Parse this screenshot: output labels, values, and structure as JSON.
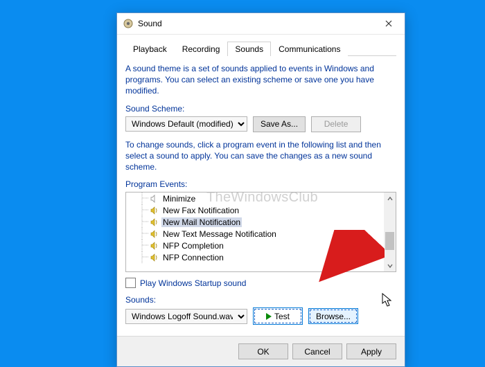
{
  "window": {
    "title": "Sound"
  },
  "tabs": [
    {
      "label": "Playback"
    },
    {
      "label": "Recording"
    },
    {
      "label": "Sounds"
    },
    {
      "label": "Communications"
    }
  ],
  "description": "A sound theme is a set of sounds applied to events in Windows and programs.  You can select an existing scheme or save one you have modified.",
  "scheme": {
    "label": "Sound Scheme:",
    "value": "Windows Default (modified)",
    "save_as": "Save As...",
    "delete": "Delete"
  },
  "events_intro": "To change sounds, click a program event in the following list and then select a sound to apply.  You can save the changes as a new sound scheme.",
  "events_label": "Program Events:",
  "events": [
    {
      "label": "Minimize",
      "has_sound": false
    },
    {
      "label": "New Fax Notification",
      "has_sound": true
    },
    {
      "label": "New Mail Notification",
      "has_sound": true,
      "selected": true
    },
    {
      "label": "New Text Message Notification",
      "has_sound": true
    },
    {
      "label": "NFP Completion",
      "has_sound": true
    },
    {
      "label": "NFP Connection",
      "has_sound": true
    }
  ],
  "startup_checkbox": "Play Windows Startup sound",
  "sounds": {
    "label": "Sounds:",
    "value": "Windows Logoff Sound.wav",
    "test": "Test",
    "browse": "Browse..."
  },
  "buttons": {
    "ok": "OK",
    "cancel": "Cancel",
    "apply": "Apply"
  },
  "watermark": "TheWindowsClub"
}
